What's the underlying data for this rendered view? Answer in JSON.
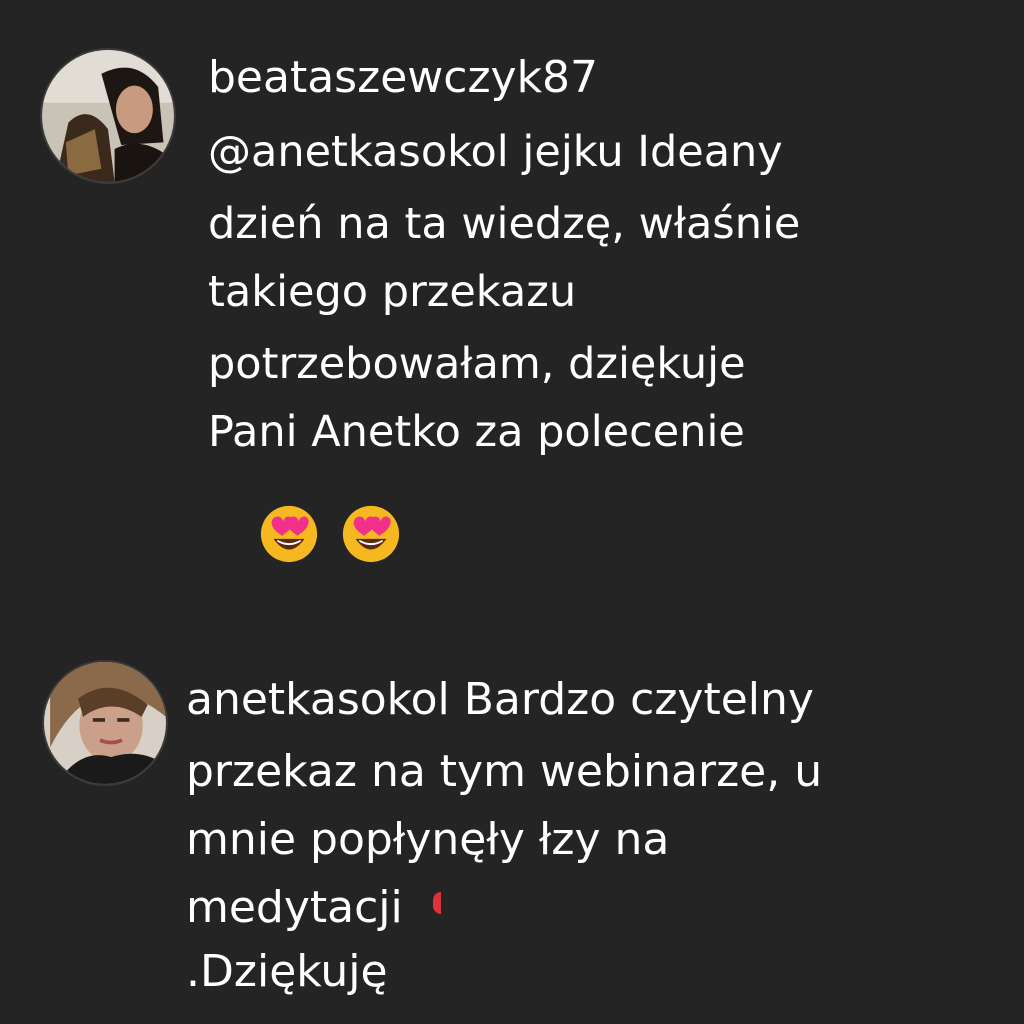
{
  "comments": [
    {
      "username": "beataszewczyk87",
      "lines": [
        "@anetkasokol jejku Ideany",
        "dzień na ta wiedzę, właśnie",
        "takiego przekazu",
        "potrzebowałam, dziękuje",
        "Pani Anetko za polecenie"
      ],
      "emojis": [
        "smiling-face-with-heart-eyes",
        "smiling-face-with-heart-eyes"
      ]
    },
    {
      "username": "anetkasokol",
      "text_first": "Bardzo czytelny",
      "lines": [
        "przekaz na tym webinarze, u",
        "mnie popłynęły łzy na",
        "medytacji",
        ".Dziękuję"
      ]
    }
  ],
  "colors": {
    "background": "#242424",
    "text": "#ffffff",
    "emoji_face": "#f5b820",
    "emoji_hearts": "#f0308a"
  }
}
